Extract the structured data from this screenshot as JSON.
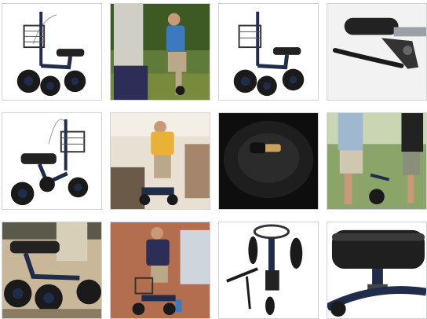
{
  "gallery": {
    "thumbnails": [
      {
        "subject": "knee-scooter-basket-side"
      },
      {
        "subject": "man-riding-scooter-outdoors"
      },
      {
        "subject": "knee-scooter-basket-side-duplicate"
      },
      {
        "subject": "handbrake-closeup"
      },
      {
        "subject": "knee-scooter-front-angle"
      },
      {
        "subject": "man-indoor-kitchen-scooter"
      },
      {
        "subject": "tire-valve-closeup"
      },
      {
        "subject": "couple-walking-with-scooter"
      },
      {
        "subject": "rider-seat-lowangle"
      },
      {
        "subject": "man-on-brick-patio-scooter"
      },
      {
        "subject": "scooter-folded-topdown"
      },
      {
        "subject": "padded-seat-closeup"
      }
    ]
  },
  "colors": {
    "frame": "#1f2c4a",
    "tire": "#1a1a1a",
    "border": "#d2d2d2"
  }
}
